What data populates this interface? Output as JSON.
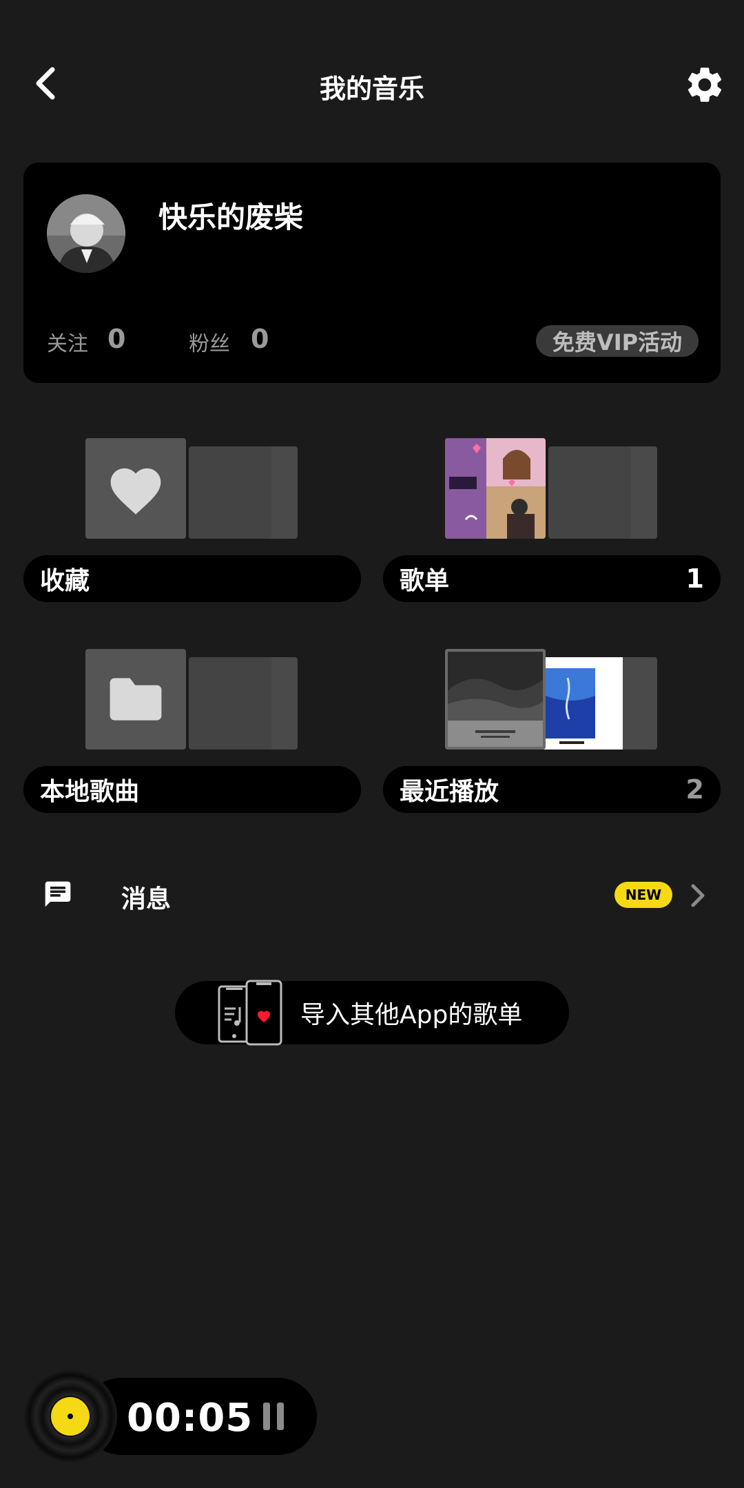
{
  "header": {
    "title": "我的音乐"
  },
  "profile": {
    "username": "快乐的废柴",
    "following_label": "关注",
    "following_count": "0",
    "fans_label": "粉丝",
    "fans_count": "0",
    "vip_button": "免费VIP活动"
  },
  "tiles": [
    {
      "label": "收藏",
      "count": ""
    },
    {
      "label": "歌单",
      "count": "1"
    },
    {
      "label": "本地歌曲",
      "count": ""
    },
    {
      "label": "最近播放",
      "count": "2"
    }
  ],
  "message": {
    "label": "消息",
    "badge": "NEW"
  },
  "import": {
    "label": "导入其他App的歌单"
  },
  "player": {
    "time": "00:05"
  },
  "colors": {
    "accent": "#f5d914",
    "background": "#1b1b1b",
    "card": "#000000"
  }
}
